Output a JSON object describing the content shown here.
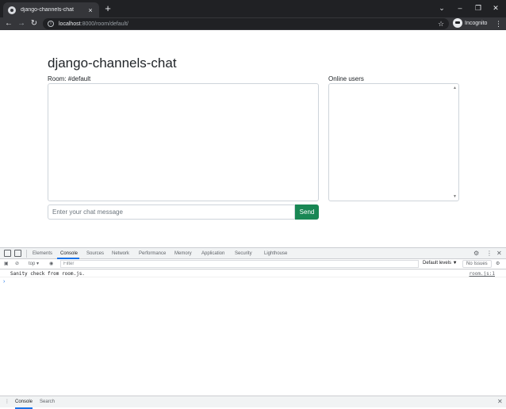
{
  "browser": {
    "tab_title": "django-channels-chat",
    "tab_close": "×",
    "new_tab": "+",
    "url_host": "localhost",
    "url_path": ":8000/room/default/",
    "profile_label": "Incognito",
    "window_controls": {
      "minimize": "⌄",
      "min": "–",
      "restore": "❐",
      "close": "✕"
    }
  },
  "page": {
    "title": "django-channels-chat",
    "room_label": "Room: #default",
    "online_users_label": "Online users",
    "message_placeholder": "Enter your chat message",
    "send_label": "Send",
    "send_color": "#198754"
  },
  "devtools": {
    "tabs": [
      "Elements",
      "Console",
      "Sources",
      "Network",
      "Performance",
      "Memory",
      "Application",
      "Security",
      "Lighthouse"
    ],
    "active_tab": "Console",
    "context": "top",
    "filter_placeholder": "Filter",
    "levels": "Default levels ▼",
    "issues": "No Issues",
    "log_message": "Sanity check from room.js.",
    "log_source": "room.js:1",
    "prompt": "›",
    "drawer_tabs": [
      "Console",
      "Search"
    ],
    "accent": "#1a73e8"
  }
}
